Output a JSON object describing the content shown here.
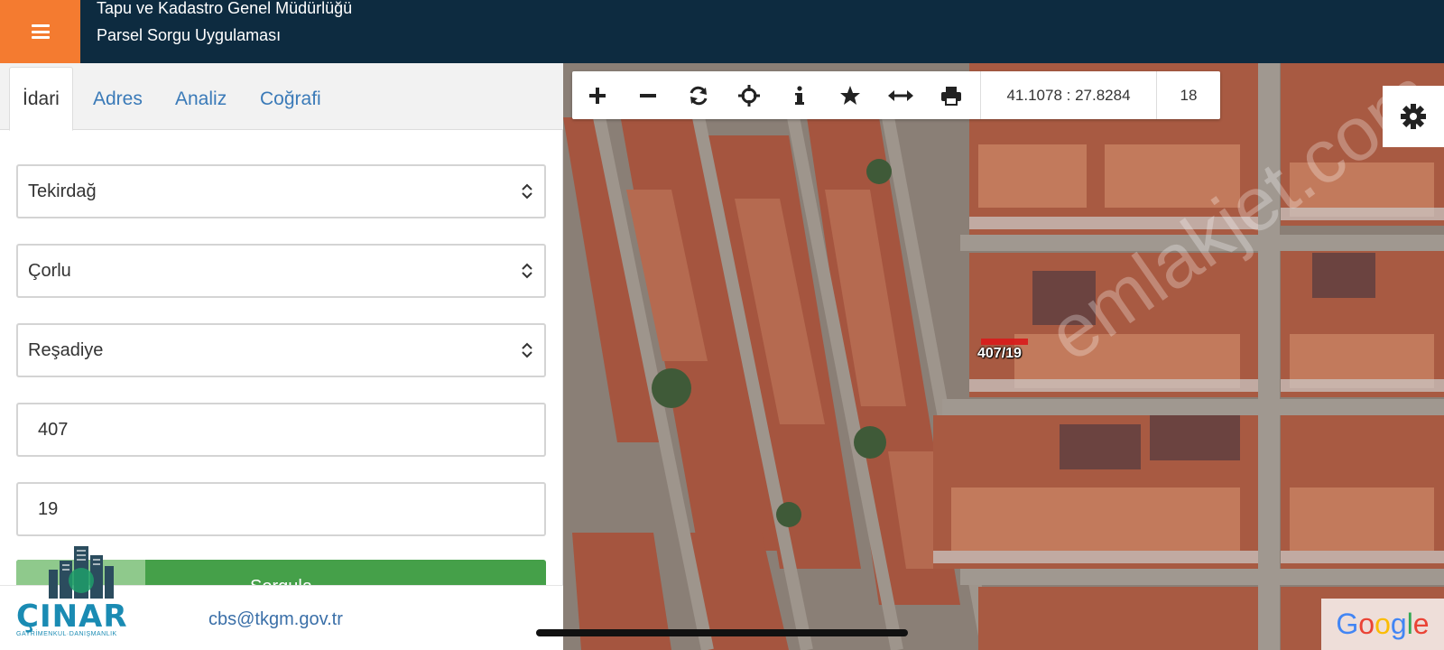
{
  "header": {
    "title_line1": "Tapu ve Kadastro Genel Müdürlüğü",
    "title_line2": "Parsel Sorgu Uygulaması",
    "accent_color": "#f47b30",
    "bg_color": "#0d2b40"
  },
  "tabs": [
    {
      "label": "İdari",
      "active": true
    },
    {
      "label": "Adres",
      "active": false
    },
    {
      "label": "Analiz",
      "active": false
    },
    {
      "label": "Coğrafi",
      "active": false
    }
  ],
  "form": {
    "il": "Tekirdağ",
    "ilce": "Çorlu",
    "mahalle": "Reşadiye",
    "ada": "407",
    "parsel": "19",
    "query_button": "Sorgula"
  },
  "footer": {
    "email": "cbs@tkgm.gov.tr",
    "logo_text": "ÇINAR",
    "logo_subtext": "GAYRİMENKUL·DANIŞMANLIK"
  },
  "map": {
    "toolbar_icons": [
      "zoom-in-icon",
      "zoom-out-icon",
      "refresh-icon",
      "locate-icon",
      "info-icon",
      "star-icon",
      "measure-icon",
      "print-icon"
    ],
    "coordinates": "41.1078 : 27.8284",
    "zoom_level": "18",
    "parcel_label": "407/19",
    "attribution": "Google",
    "watermark": "emlakjet.com"
  }
}
